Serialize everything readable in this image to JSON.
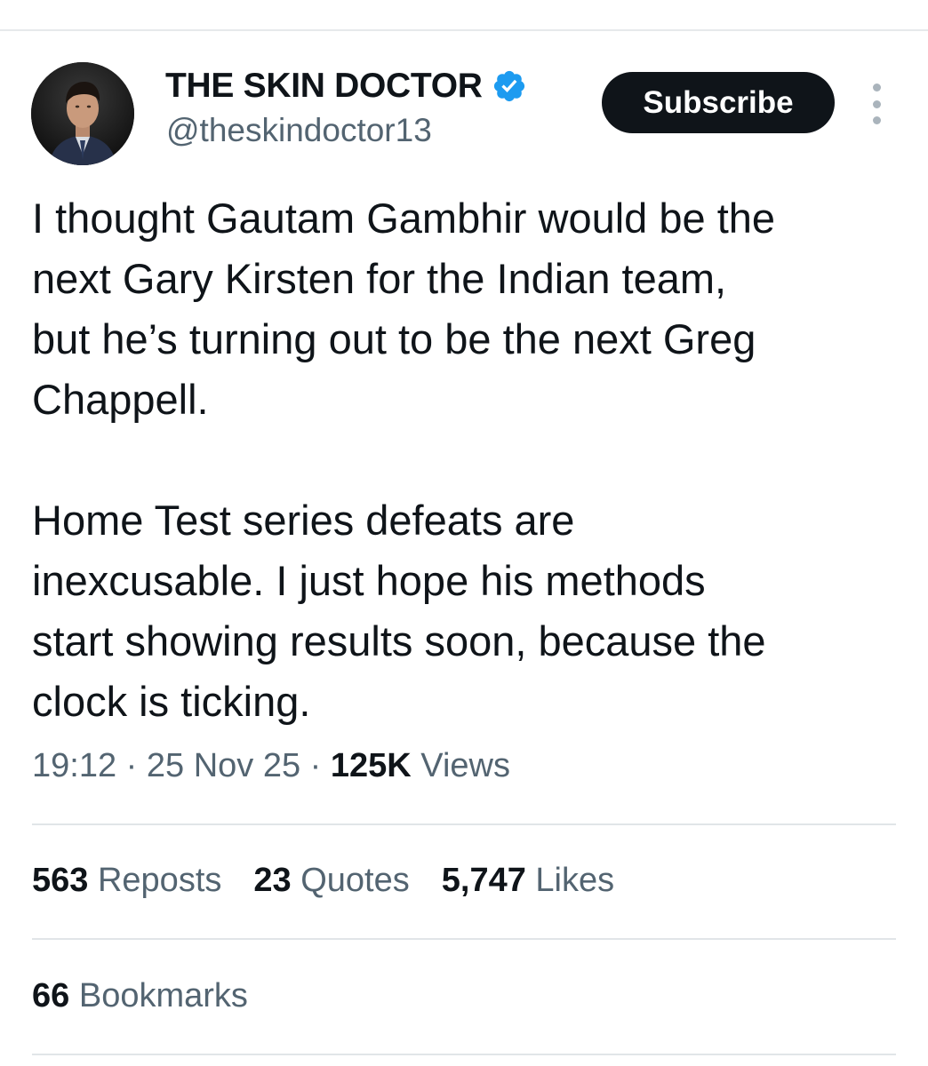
{
  "author": {
    "name": "THE SKIN DOCTOR",
    "handle": "@theskindoctor13",
    "verified_color": "#1d9bf0"
  },
  "actions": {
    "subscribe_label": "Subscribe",
    "more_icon": "more-vertical-icon"
  },
  "tweet": {
    "paragraphs": [
      "I thought Gautam Gambhir would be the\nnext Gary Kirsten for the Indian team,\nbut he’s turning out to be the next Greg\nChappell.",
      "Home Test series defeats are\ninexcusable. I just hope his methods\nstart showing results soon, because the\nclock is ticking."
    ],
    "time": "19:12",
    "date": "25 Nov 25",
    "views_count": "125K",
    "views_label": "Views"
  },
  "stats": [
    {
      "count": "563",
      "label": "Reposts"
    },
    {
      "count": "23",
      "label": "Quotes"
    },
    {
      "count": "5,747",
      "label": "Likes"
    }
  ],
  "bookmarks": {
    "count": "66",
    "label": "Bookmarks"
  },
  "colors": {
    "text": "#0f1419",
    "secondary": "#536471",
    "divider": "#e1e5e8",
    "button_bg": "#0f1419"
  }
}
